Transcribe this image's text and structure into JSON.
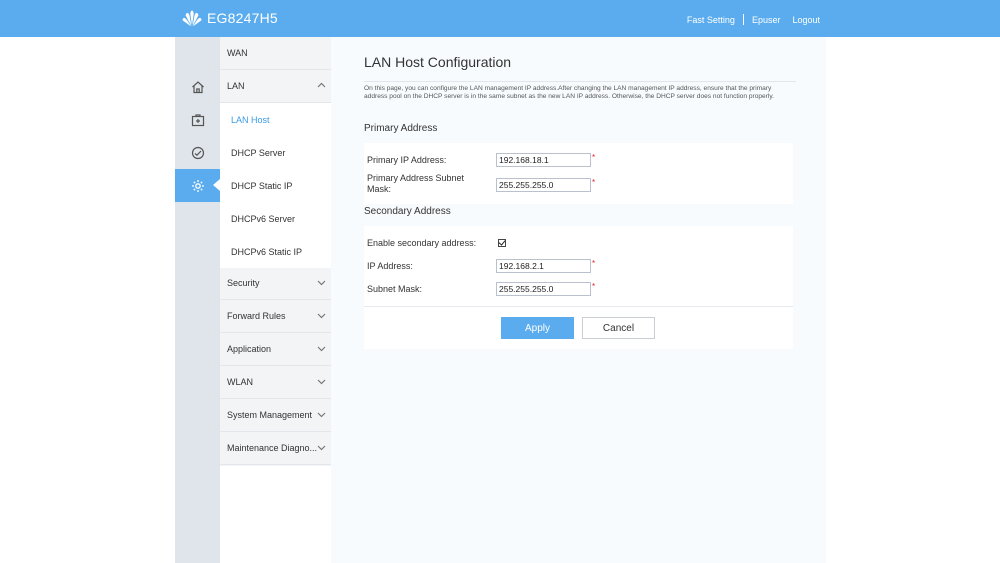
{
  "header": {
    "product_name": "EG8247H5",
    "links": [
      "Fast Setting",
      "Epuser",
      "Logout"
    ]
  },
  "iconbar": {
    "items": [
      {
        "icon": "home-icon"
      },
      {
        "icon": "toolbox-icon"
      },
      {
        "icon": "diagnose-icon"
      },
      {
        "icon": "gear-icon",
        "active": true
      }
    ]
  },
  "nav": {
    "wan": "WAN",
    "lan": "LAN",
    "lan_sub": [
      "LAN Host",
      "DHCP Server",
      "DHCP Static IP",
      "DHCPv6 Server",
      "DHCPv6 Static IP"
    ],
    "active_sub": "LAN Host",
    "groups": [
      "Security",
      "Forward Rules",
      "Application",
      "WLAN",
      "System Management",
      "Maintenance Diagno..."
    ]
  },
  "page": {
    "title": "LAN Host Configuration",
    "description": "On this page, you can configure the LAN management IP address.After changing the LAN management IP address, ensure that the primary address pool on the DHCP server is in the same subnet as the new LAN IP address. Otherwise, the DHCP server does not function properly.",
    "primary": {
      "title": "Primary Address",
      "ip_label": "Primary IP Address:",
      "ip_value": "192.168.18.1",
      "mask_label": "Primary Address Subnet Mask:",
      "mask_value": "255.255.255.0"
    },
    "secondary": {
      "title": "Secondary Address",
      "enable_label": "Enable secondary address:",
      "enabled": true,
      "ip_label": "IP Address:",
      "ip_value": "192.168.2.1",
      "mask_label": "Subnet Mask:",
      "mask_value": "255.255.255.0"
    },
    "required_mark": "*",
    "apply_label": "Apply",
    "cancel_label": "Cancel"
  },
  "colors": {
    "accent": "#5aacee",
    "active_text": "#3a9be6",
    "required": "#e02020"
  }
}
